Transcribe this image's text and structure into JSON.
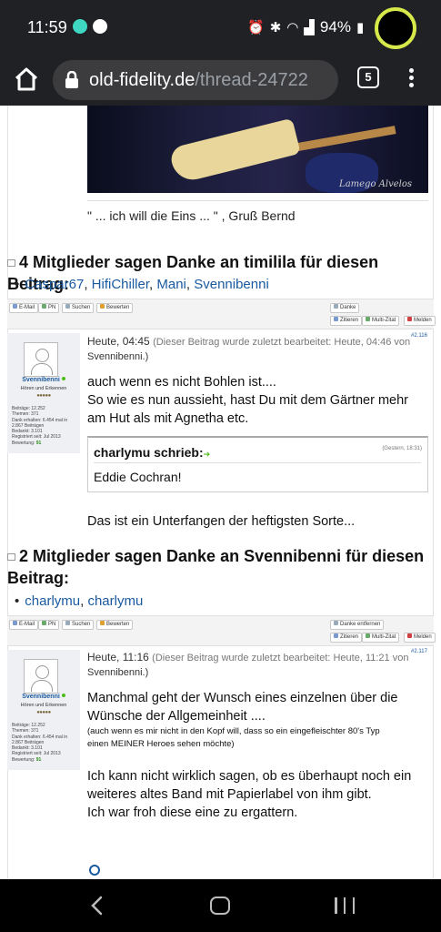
{
  "status_bar": {
    "time": "11:59",
    "battery": "94%",
    "left_icons": [
      "teal-app-icon",
      "spotify-icon"
    ],
    "right_icons": [
      "alarm-icon",
      "bluetooth-icon",
      "wifi-icon",
      "signal-icon",
      "battery-icon"
    ]
  },
  "browser": {
    "url_domain": "old-fidelity.de",
    "url_path": "/thread-24722",
    "tab_count": "5"
  },
  "post_top": {
    "image_watermark": "Lamego Alvelos",
    "signature": "\" ... ich will die Eins ... \"  ,  Gruß Bernd"
  },
  "thanks_1": {
    "title": "4 Mitglieder sagen Danke an timilila für diesen Beitrag:",
    "names": [
      "Caspar67",
      "HifiChiller",
      "Mani",
      "Svennibenni"
    ]
  },
  "buttons_1": {
    "email": "E-Mail",
    "pm": "PN",
    "search": "Suchen",
    "rate": "Bewerten",
    "thanks": "Danke",
    "quote": "Zitieren",
    "multiquote": "Multi-Zitat",
    "report": "Melden"
  },
  "post_2": {
    "time": "Heute, 04:45",
    "edit_note": "(Dieser Beitrag wurde zuletzt bearbeitet: Heute, 04:46 von",
    "edit_user": "Svennibenni.)",
    "post_number": "#2.116",
    "author": {
      "name": "Svennibenni",
      "rank": "Hören und Erkennen",
      "stars": "●●●●●",
      "stats": [
        "Beiträge: 12.252",
        "Themen: 371",
        "Dank erhalten: 6.454 mal in 2.867 Beiträgen",
        "Bedankt: 3.101",
        "Registriert seit: Jul 2013"
      ],
      "rating_label": "Bewertung:",
      "rating_value": "91"
    },
    "line1": "auch wenn es nicht Bohlen ist....",
    "line2": "So wie es nun aussieht, hast Du mit dem Gärtner mehr",
    "line3": "am Hut als mit Agnetha etc.",
    "quote": {
      "author": "charlymu schrieb:",
      "time": "(Gestern, 18:31)",
      "text": "Eddie Cochran!"
    },
    "after_quote": "Das ist ein Unterfangen der heftigsten Sorte..."
  },
  "thanks_2": {
    "title_line1": "2 Mitglieder sagen Danke an Svennibenni für diesen",
    "title_line2": "Beitrag:",
    "names": [
      "charlymu",
      "charlymu"
    ]
  },
  "buttons_2": {
    "email": "E-Mail",
    "pm": "PN",
    "search": "Suchen",
    "rate": "Bewerten",
    "thanks_remove": "Danke entfernen",
    "quote": "Zitieren",
    "multiquote": "Multi-Zitat",
    "report": "Melden"
  },
  "post_3": {
    "time": "Heute, 11:16",
    "edit_note": "(Dieser Beitrag wurde zuletzt bearbeitet: Heute, 11:21 von",
    "edit_user": "Svennibenni.)",
    "post_number": "#2.117",
    "author": {
      "name": "Svennibenni",
      "rank": "Hören und Erkennen",
      "stars": "●●●●●",
      "stats": [
        "Beiträge: 12.252",
        "Themen: 371",
        "Dank erhalten: 6.454 mal in 2.867 Beiträgen",
        "Bedankt: 3.101",
        "Registriert seit: Jul 2013"
      ],
      "rating_label": "Bewertung:",
      "rating_value": "91"
    },
    "line1": "Manchmal geht der Wunsch eines einzelnen über die",
    "line2": "Wünsche der Allgemeinheit ....",
    "small1": "(auch wenn es mir nicht in den Kopf will, dass so ein eingefleischter 80's Typ",
    "small2": "einen MEINER Heroes sehen möchte)",
    "line3": "Ich kann nicht wirklich sagen, ob es überhaupt noch ein",
    "line4": "weiteres altes Band mit Papierlabel von ihm gibt.",
    "line5": "Ich war froh diese eine zu ergattern."
  },
  "nav_bar": {
    "buttons": [
      "back-button",
      "home-button",
      "recents-button"
    ]
  },
  "colors": {
    "system_bar": "#202124",
    "link": "#1a5aa0",
    "online": "#4cbb17",
    "accent_ring": "#d6e84a"
  }
}
